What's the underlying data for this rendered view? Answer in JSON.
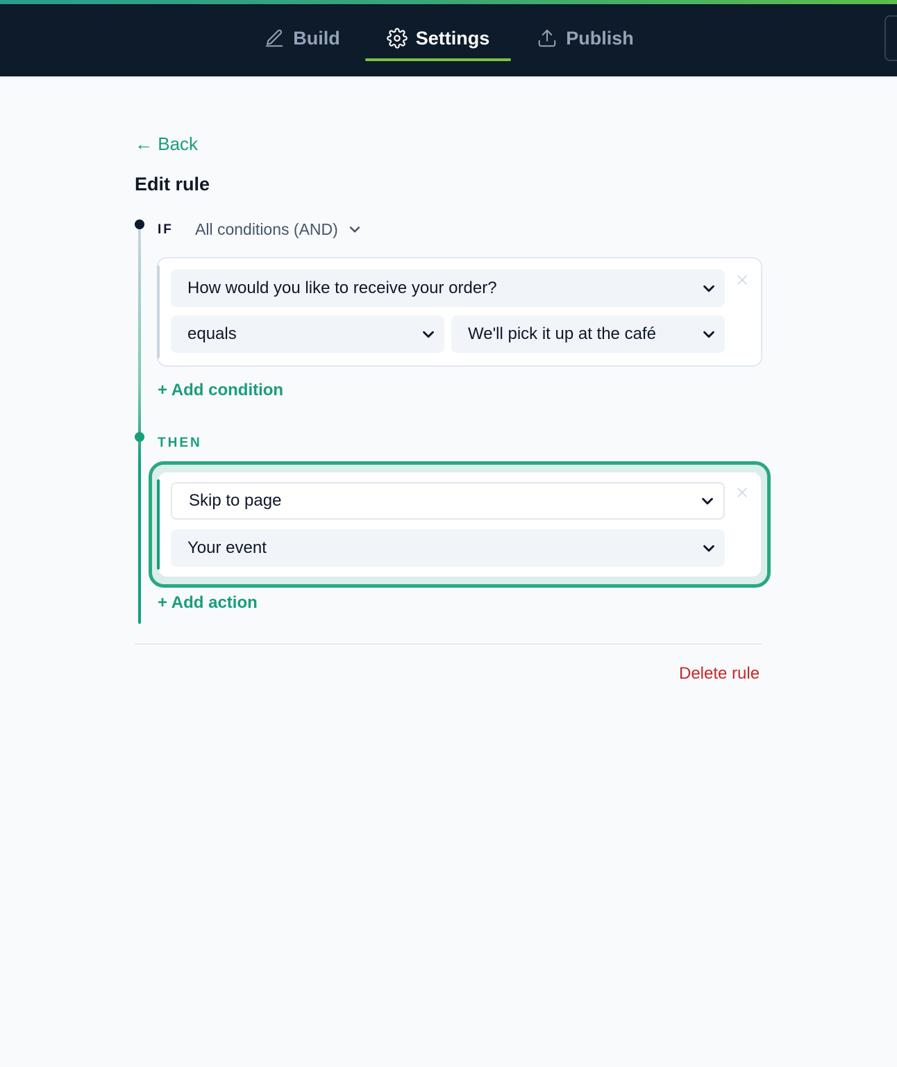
{
  "nav": {
    "tabs": [
      {
        "label": "Build",
        "icon": "pencil-icon",
        "active": false
      },
      {
        "label": "Settings",
        "icon": "gear-icon",
        "active": true
      },
      {
        "label": "Publish",
        "icon": "upload-icon",
        "active": false
      }
    ]
  },
  "page": {
    "back_label": "← Back",
    "title": "Edit rule"
  },
  "rule": {
    "if_label": "IF",
    "logic_value": "All conditions (AND)",
    "condition": {
      "field": "How would you like to receive your order?",
      "operator": "equals",
      "value": "We'll pick it up at the café"
    },
    "add_condition_label": "+ Add condition",
    "then_label": "THEN",
    "action": {
      "type": "Skip to page",
      "target": "Your event"
    },
    "add_action_label": "+ Add action",
    "delete_label": "Delete rule"
  },
  "colors": {
    "topbar_bg": "#0d1b2a",
    "accent_green": "#1a9d7d",
    "active_underline": "#7cc242",
    "danger": "#c62828"
  }
}
